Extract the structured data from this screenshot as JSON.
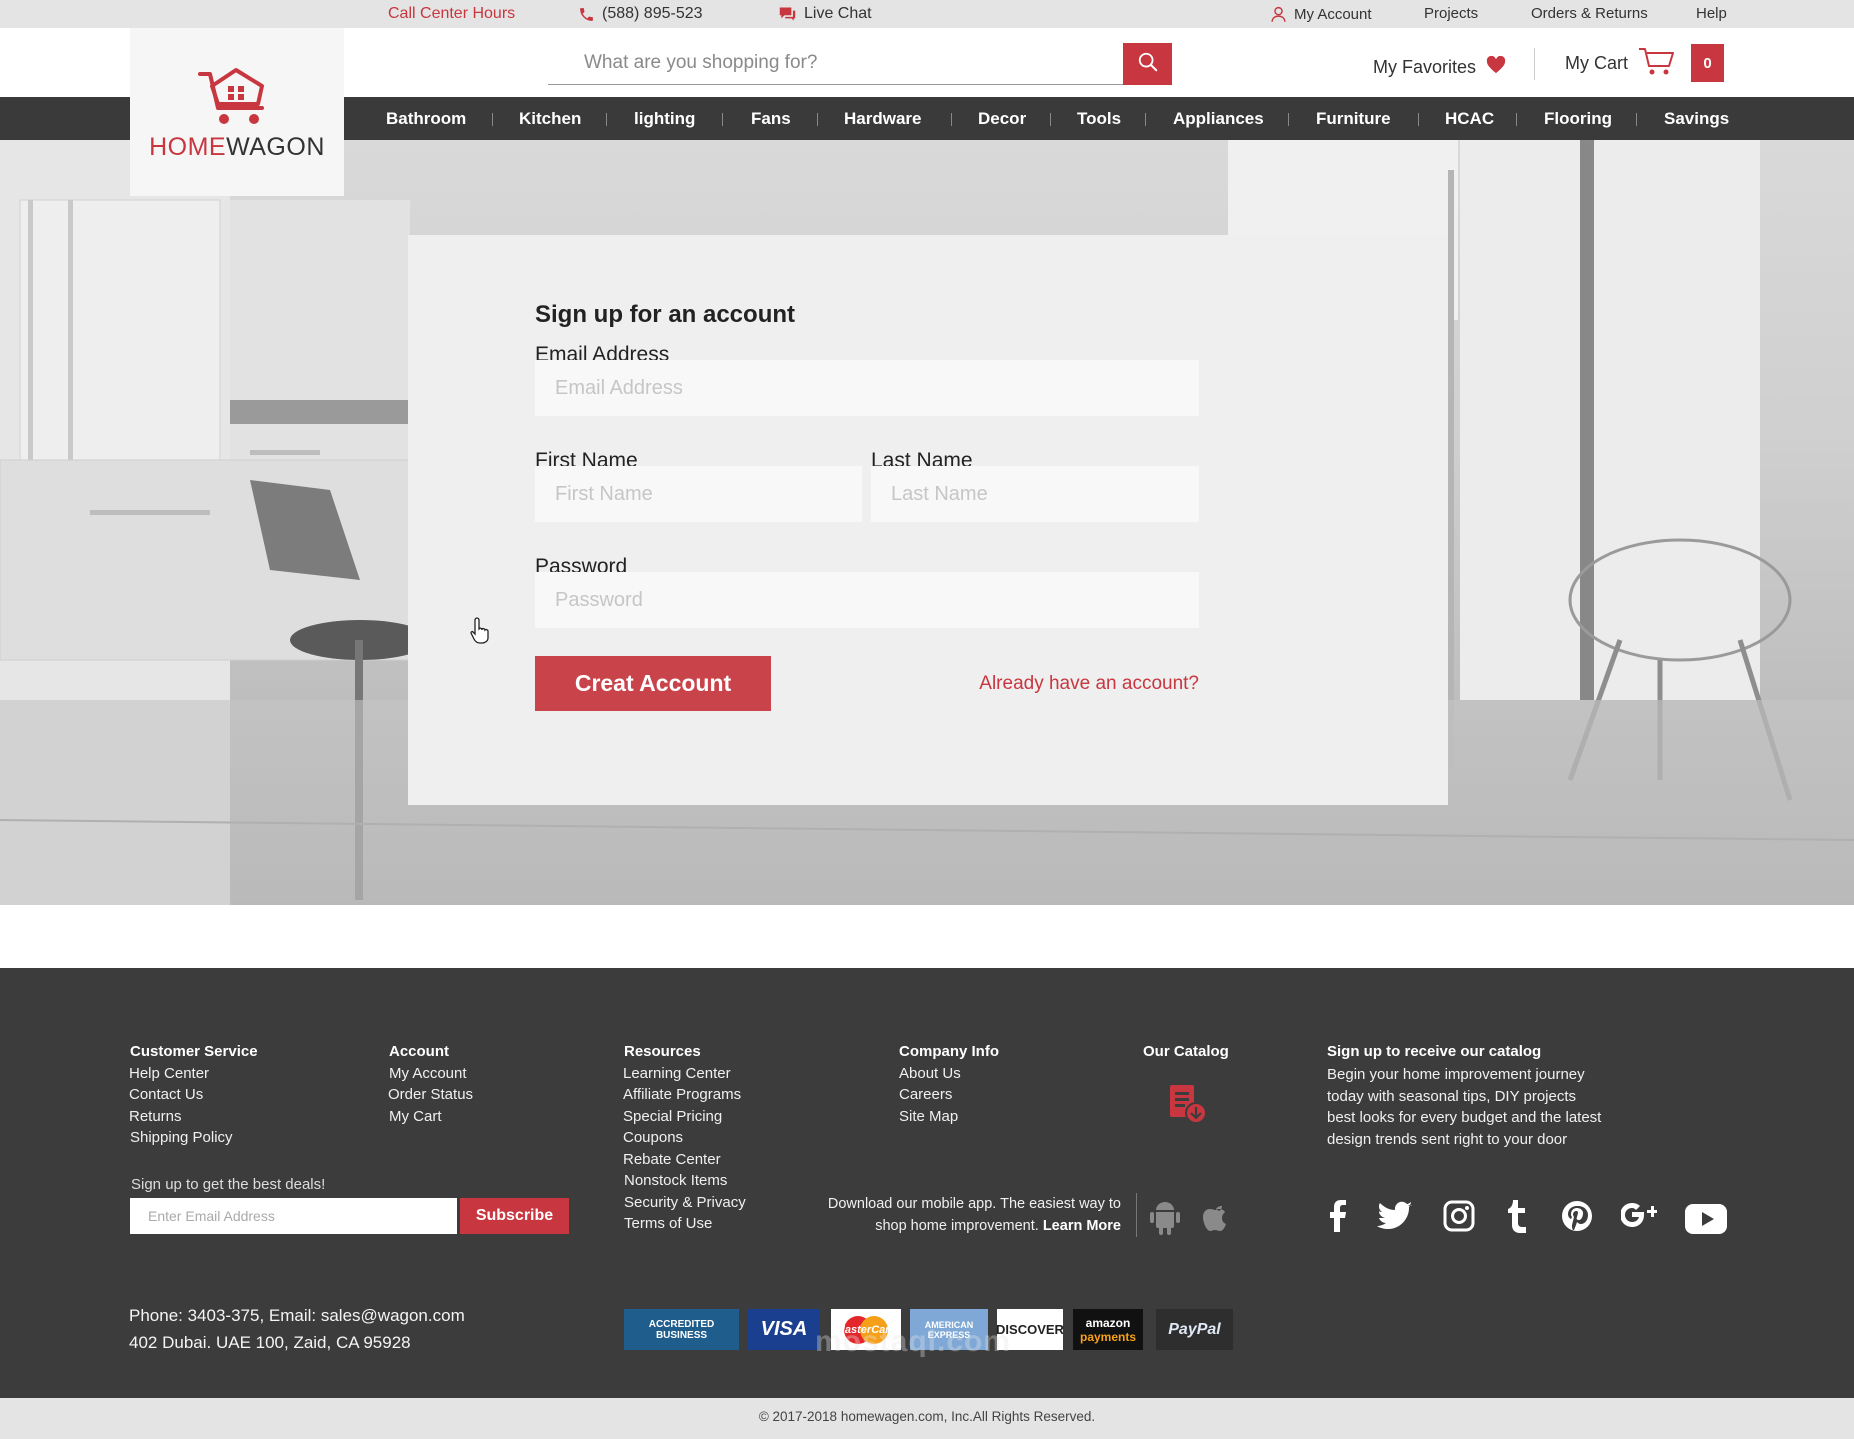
{
  "topbar": {
    "call_center": "Call Center Hours",
    "phone": "(588) 895-523",
    "live_chat": "Live Chat",
    "my_account": "My Account",
    "projects": "Projects",
    "orders_returns": "Orders & Returns",
    "help": "Help"
  },
  "brand": {
    "home": "HOME",
    "wagon": "WAGON"
  },
  "search": {
    "placeholder": "What are you shopping for?"
  },
  "header": {
    "favorites": "My Favorites",
    "cart": "My Cart",
    "cart_count": "0"
  },
  "nav": {
    "items": [
      "Bathroom",
      "Kitchen",
      "lighting",
      "Fans",
      "Hardware",
      "Decor",
      "Tools",
      "Appliances",
      "Furniture",
      "HCAC",
      "Flooring",
      "Savings"
    ]
  },
  "signup": {
    "title": "Sign up for an account",
    "email_label": "Email Address",
    "email_placeholder": "Email Address",
    "first_label": "First Name",
    "first_placeholder": "First Name",
    "last_label": "Last Name",
    "last_placeholder": "Last Name",
    "password_label": "Password",
    "password_placeholder": "Password",
    "create_button": "Creat Account",
    "already_link": "Already have an account?"
  },
  "footer": {
    "customer_service": {
      "heading": "Customer Service",
      "links": [
        "Help Center",
        "Contact Us",
        "Returns",
        "Shipping Policy"
      ]
    },
    "account": {
      "heading": "Account",
      "links": [
        "My Account",
        "Order Status",
        "My Cart"
      ]
    },
    "resources": {
      "heading": "Resources",
      "links": [
        "Learning Center",
        "Affiliate Programs",
        "Special Pricing",
        "Coupons",
        "Rebate Center",
        "Nonstock Items",
        "Security & Privacy",
        "Terms of Use"
      ]
    },
    "company": {
      "heading": "Company Info",
      "links": [
        "About Us",
        "Careers",
        "Site Map"
      ]
    },
    "catalog": {
      "heading": "Our Catalog"
    },
    "signup_catalog": {
      "heading": "Sign up to receive our catalog",
      "lines": [
        "Begin your home improvement journey",
        "today with seasonal tips, DIY projects",
        "best looks for every budget and the latest",
        "design trends sent right to your door"
      ]
    },
    "deals": {
      "label": "Sign up to get the best deals!",
      "placeholder": "Enter Email Address",
      "button": "Subscribe"
    },
    "app": {
      "line1": "Download our mobile app. The easiest way to",
      "line2": "shop home improvement.",
      "learn_more": "Learn More"
    },
    "contact": {
      "line1": "Phone: 3403-375, Email: sales@wagon.com",
      "line2": "402 Dubai. UAE 100, Zaid, CA 95928"
    },
    "payments": {
      "bbb_line1": "ACCREDITED",
      "bbb_line2": "BUSINESS",
      "visa": "VISA",
      "mastercard": "MasterCard",
      "amex_line1": "AMERICAN",
      "amex_line2": "EXPRESS",
      "discover": "DISCOVER",
      "amazon_line1": "amazon",
      "amazon_line2": "payments",
      "paypal": "PayPal"
    },
    "social_icons": [
      "facebook-icon",
      "twitter-icon",
      "instagram-icon",
      "tumblr-icon",
      "pinterest-icon",
      "google-plus-icon",
      "youtube-icon"
    ],
    "copyright": "© 2017-2018 homewagen.com, Inc.All Rights Reserved.",
    "watermark": "mostaql.com"
  },
  "colors": {
    "accent": "#c8363f",
    "nav_bg": "#3a3a3a",
    "footer_bg": "#3c3c3c",
    "topbar_bg": "#e4e4e4"
  }
}
